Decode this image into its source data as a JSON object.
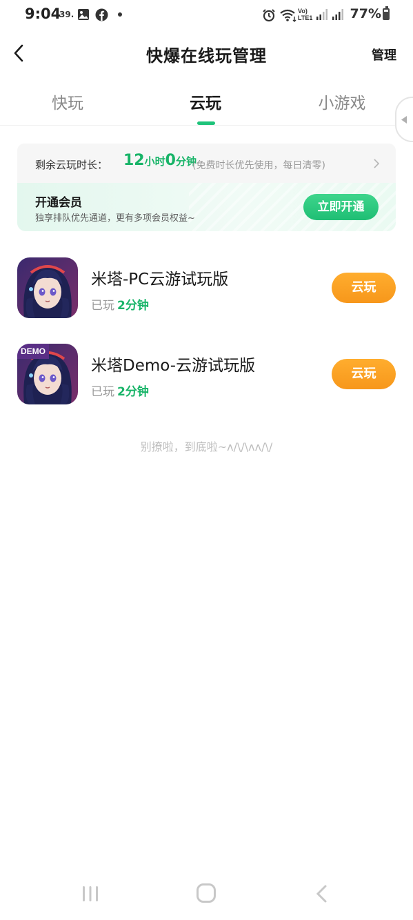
{
  "status_bar": {
    "time": "9:04",
    "notif_text": "39.",
    "battery": "77%",
    "icons": [
      "gallery-icon",
      "facebook-icon",
      "dot-icon",
      "alarm-icon",
      "wifi-icon",
      "volte-icon",
      "signal-icon",
      "battery-icon"
    ]
  },
  "header": {
    "title": "快爆在线玩管理",
    "manage_label": "管理"
  },
  "tabs": [
    {
      "label": "快玩",
      "active": false
    },
    {
      "label": "云玩",
      "active": true
    },
    {
      "label": "小游戏",
      "active": false
    }
  ],
  "time_card": {
    "label": "剩余云玩时长：",
    "hours": "12",
    "hours_unit": "小时",
    "minutes": "0",
    "minutes_unit": "分钟",
    "note": "(免费时长优先使用，每日清零)"
  },
  "member_card": {
    "title": "开通会员",
    "desc": "独享排队优先通道，更有多项会员权益~",
    "button_label": "立即开通"
  },
  "games": [
    {
      "name": "米塔-PC云游试玩版",
      "played_label": "已玩",
      "played_value": "2分钟",
      "button_label": "云玩",
      "badge": ""
    },
    {
      "name": "米塔Demo-云游试玩版",
      "played_label": "已玩",
      "played_value": "2分钟",
      "button_label": "云玩",
      "badge": "DEMO"
    }
  ],
  "end_text": "别撩啦，到底啦~ʌ/\\/\\ʌʌ/\\/",
  "colors": {
    "accent_green": "#18b468",
    "play_orange": "#f7971b",
    "member_bg": "#e3f7ee"
  }
}
